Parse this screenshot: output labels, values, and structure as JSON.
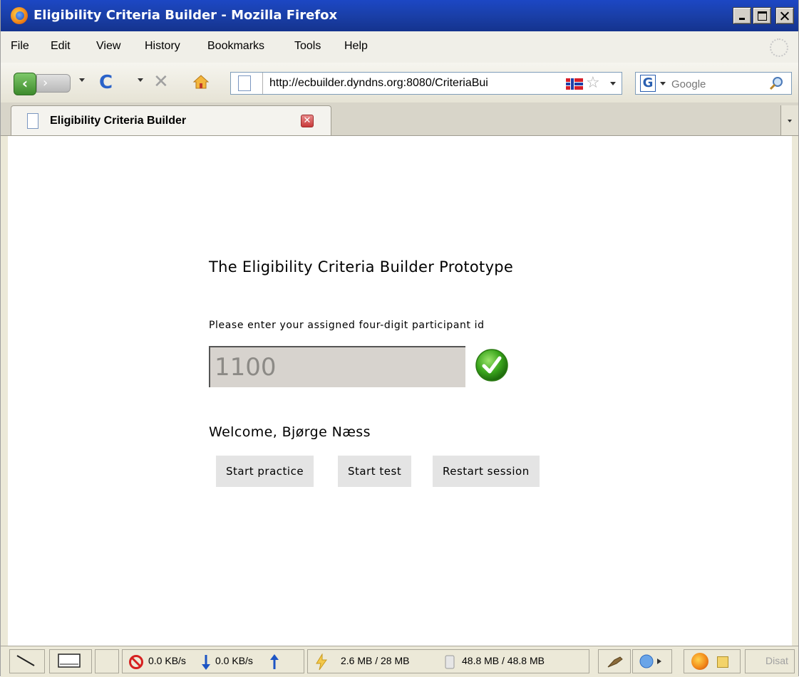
{
  "window": {
    "title": "Eligibility Criteria Builder - Mozilla Firefox"
  },
  "menubar": {
    "items": [
      "File",
      "Edit",
      "View",
      "History",
      "Bookmarks",
      "Tools",
      "Help"
    ]
  },
  "navbar": {
    "url": "http://ecbuilder.dyndns.org:8080/CriteriaBui",
    "search_placeholder": "Google",
    "search_engine_letter": "G"
  },
  "tab": {
    "label": "Eligibility Criteria Builder"
  },
  "page": {
    "title": "The Eligibility Criteria Builder Prototype",
    "prompt": "Please enter your assigned four-digit participant id",
    "participant_id": "1100",
    "welcome": "Welcome, Bjørge Næss",
    "buttons": {
      "practice": "Start practice",
      "test": "Start test",
      "restart": "Restart session"
    }
  },
  "statusbar": {
    "download_rate": "0.0 KB/s",
    "upload_rate": "0.0 KB/s",
    "memory_1": "2.6 MB / 28 MB",
    "memory_2": "48.8 MB / 48.8 MB",
    "disabled_label": "Disat"
  },
  "colors": {
    "titlebar": "#1c47c4",
    "input_bg": "#d7d3ce",
    "button_bg": "#e4e4e4",
    "check_green": "#3aa51c"
  },
  "icons": [
    "firefox-logo-icon",
    "back-arrow-icon",
    "forward-arrow-icon",
    "reload-icon",
    "stop-icon",
    "home-icon",
    "page-icon",
    "norway-flag-icon",
    "bookmark-star-icon",
    "search-icon",
    "tab-close-icon",
    "checkmark-icon",
    "blocked-icon",
    "download-arrow-icon",
    "upload-arrow-icon",
    "lightning-icon"
  ]
}
